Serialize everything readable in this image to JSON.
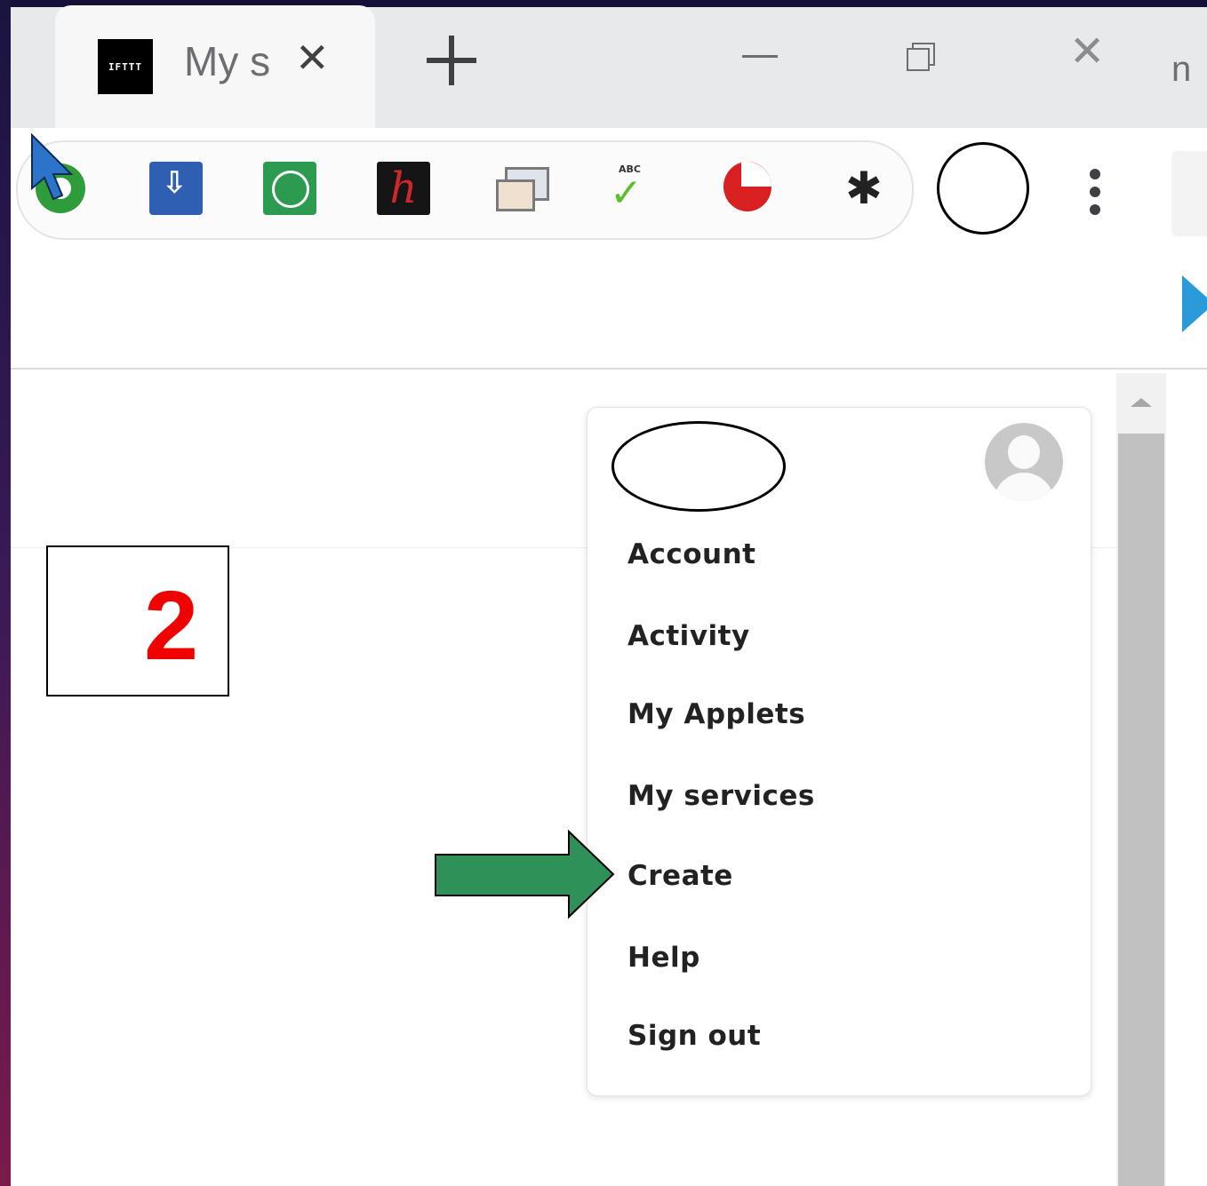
{
  "browser": {
    "tab": {
      "favicon_text": "IFTTT",
      "title": "My s",
      "close_glyph": "✕"
    },
    "window_controls_extra": "n",
    "extensions": [
      "green-circle-extension-icon",
      "download-extension-icon",
      "teamviewer-extension-icon",
      "h-extension-icon",
      "window-capture-extension-icon",
      "abc-spellcheck-extension-icon",
      "red-l-extension-icon",
      "puzzle-extensions-icon"
    ]
  },
  "annotation": {
    "step_number": "2"
  },
  "dropdown": {
    "items": [
      {
        "label": "Account"
      },
      {
        "label": "Activity"
      },
      {
        "label": "My Applets"
      },
      {
        "label": "My services"
      },
      {
        "label": "Create"
      },
      {
        "label": "Help"
      },
      {
        "label": "Sign out"
      }
    ]
  },
  "colors": {
    "arrow": "#2e9158",
    "step_number": "#f10000",
    "tv_green": "#2d9b4f"
  }
}
